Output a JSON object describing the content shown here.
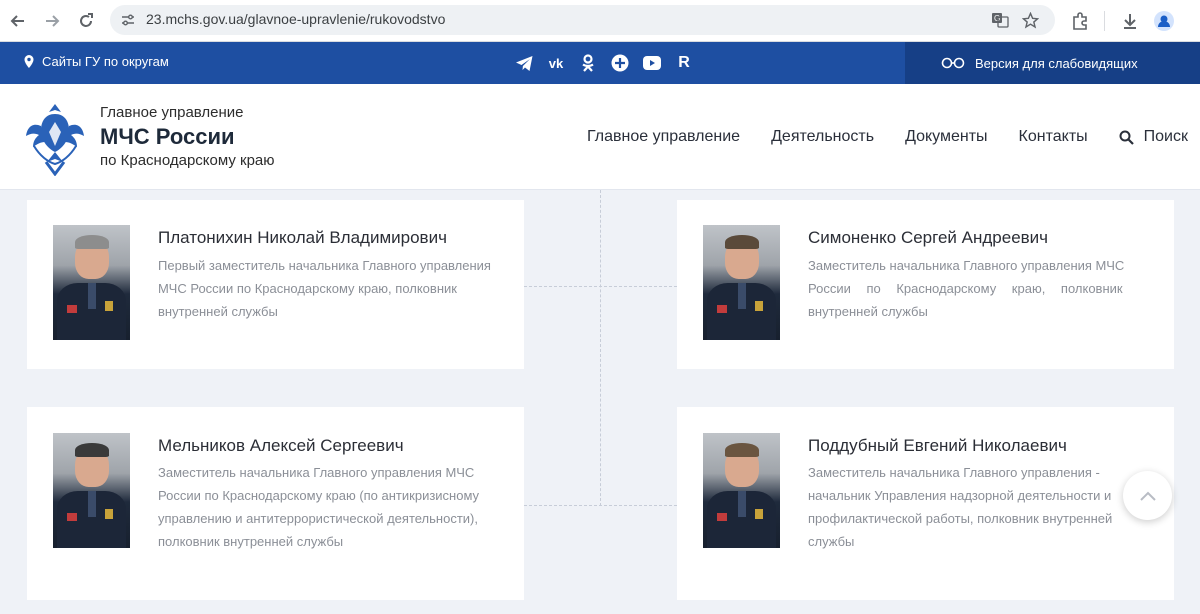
{
  "browser": {
    "url": "23.mchs.gov.ua/glavnoe-upravlenie/rukovodstvo",
    "icons": [
      "back-icon",
      "forward-icon",
      "reload-icon",
      "site-settings-icon",
      "translate-icon",
      "star-icon",
      "extensions-icon",
      "download-icon",
      "profile-icon"
    ]
  },
  "topbar": {
    "regions_label": "Сайты ГУ по округам",
    "social": [
      "telegram-icon",
      "vk-icon",
      "ok-icon",
      "plus-icon",
      "youtube-icon",
      "rutube-icon"
    ],
    "rutube_letter": "R",
    "vk_letter": "vk",
    "vision_label": "Версия для слабовидящих"
  },
  "header": {
    "org_line1": "Главное управление",
    "org_line2": "МЧС России",
    "org_line3": "по Краснодарскому краю",
    "nav": [
      "Главное управление",
      "Деятельность",
      "Документы",
      "Контакты"
    ],
    "search_label": "Поиск"
  },
  "colors": {
    "brand_blue": "#1e4fa2",
    "brand_dark_blue": "#163f86",
    "text_muted": "#8b8f97"
  },
  "leaders": [
    {
      "name": "Платонихин Николай Владимирович",
      "position_lines": [
        "Первый заместитель начальника Главного управления",
        "МЧС России по Краснодарскому краю,  полковник",
        "внутренней службы"
      ]
    },
    {
      "name": "Симоненко Сергей Андреевич",
      "position_lines": [
        "Заместитель начальника Главного управления МЧС",
        "России по Краснодарскому краю, полковник",
        "внутренней службы"
      ]
    },
    {
      "name": "Мельников Алексей Сергеевич",
      "position_lines": [
        "Заместитель начальника Главного управления МЧС",
        "России по Краснодарскому краю (по антикризисному",
        "управлению и антитеррористической деятельности),",
        "полковник внутренней службы"
      ]
    },
    {
      "name": "Поддубный Евгений Николаевич",
      "position_lines": [
        "Заместитель начальника Главного управления -",
        "начальник Управления надзорной деятельности и",
        "профилактической работы, полковник внутренней",
        "службы"
      ]
    }
  ]
}
